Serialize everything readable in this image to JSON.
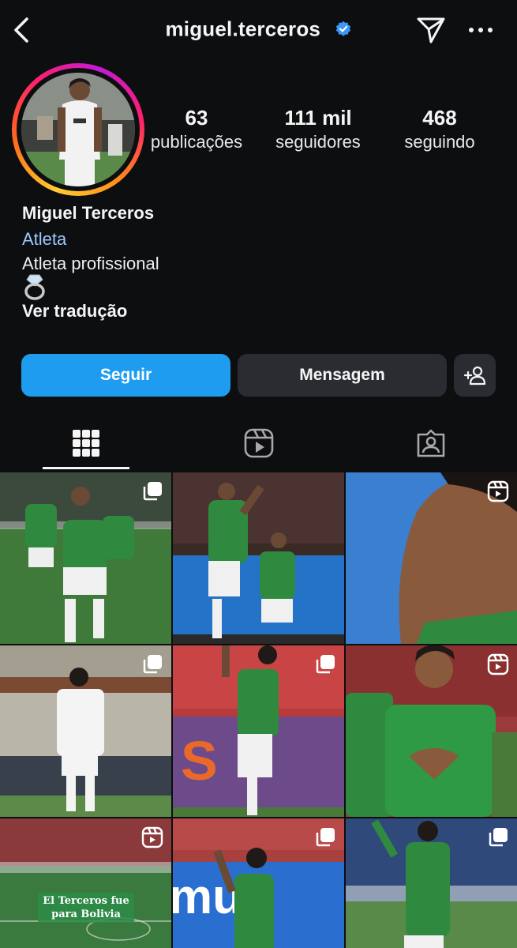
{
  "header": {
    "username": "miguel.terceros",
    "icons": {
      "back": "chevron-left-icon",
      "verified": "verified-badge-icon",
      "send": "paper-plane-icon",
      "more": "more-horizontal-icon"
    }
  },
  "stats": [
    {
      "value": "63",
      "label": "publicações"
    },
    {
      "value": "111 mil",
      "label": "seguidores"
    },
    {
      "value": "468",
      "label": "seguindo"
    }
  ],
  "bio": {
    "name": "Miguel Terceros",
    "category": "Atleta",
    "description": "Atleta profissional",
    "emoji": "ring-emoji",
    "translate_link": "Ver tradução"
  },
  "actions": {
    "follow_label": "Seguir",
    "message_label": "Mensagem",
    "add_icon": "add-person-icon"
  },
  "tabs": [
    {
      "name": "grid-icon",
      "active": true
    },
    {
      "name": "reels-icon",
      "active": false
    },
    {
      "name": "tagged-icon",
      "active": false
    }
  ],
  "grid_caption": {
    "line1": "El Terceros fue",
    "line2": "para Bolivia"
  },
  "colors": {
    "background": "#0d0e10",
    "follow": "#1e9cf0",
    "secondary_button": "#2a2c31",
    "category_link": "#9cc9ff",
    "verified": "#3b97f5"
  }
}
